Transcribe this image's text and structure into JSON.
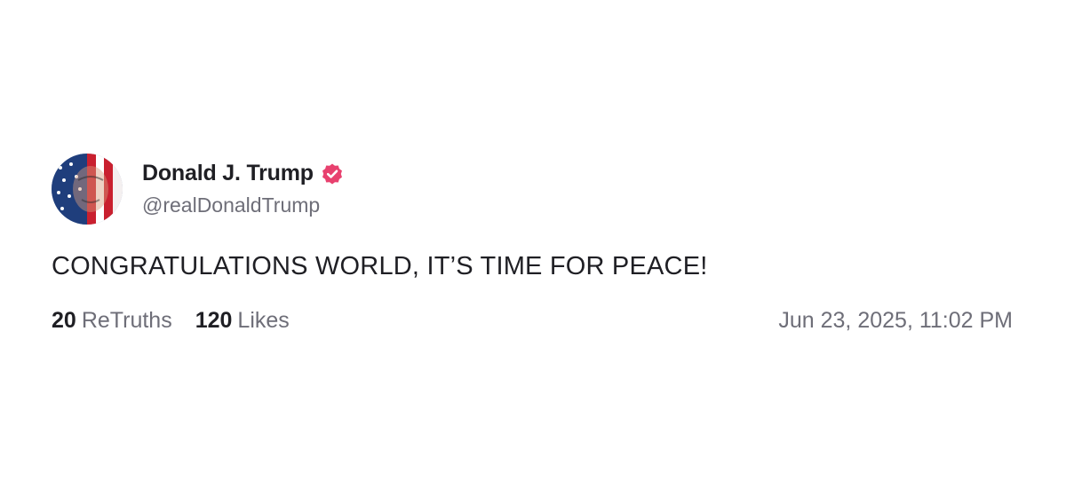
{
  "post": {
    "author": {
      "display_name": "Donald J. Trump",
      "handle": "@realDonaldTrump",
      "verified": true,
      "verified_icon": "verified-badge-icon",
      "verified_color": "#e8416f",
      "avatar": "flag-portrait-avatar"
    },
    "text": "CONGRATULATIONS WORLD, IT’S TIME FOR PEACE!",
    "stats": {
      "retruths_count": "20",
      "retruths_label": "ReTruths",
      "likes_count": "120",
      "likes_label": "Likes"
    },
    "timestamp": "Jun 23, 2025, 11:02 PM"
  }
}
